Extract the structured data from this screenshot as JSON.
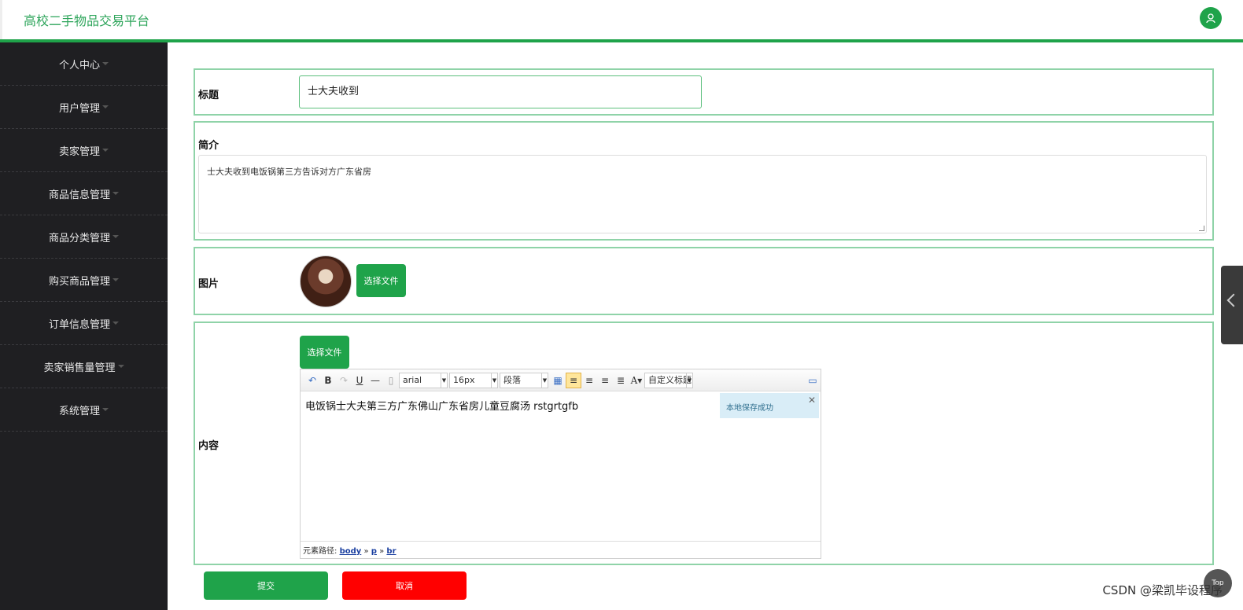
{
  "app": {
    "brand": "高校二手物品交易平台"
  },
  "sidebar": {
    "items": [
      {
        "label": "个人中心"
      },
      {
        "label": "用户管理"
      },
      {
        "label": "卖家管理"
      },
      {
        "label": "商品信息管理"
      },
      {
        "label": "商品分类管理"
      },
      {
        "label": "购买商品管理"
      },
      {
        "label": "订单信息管理"
      },
      {
        "label": "卖家销售量管理"
      },
      {
        "label": "系统管理"
      }
    ]
  },
  "form": {
    "title_label": "标题",
    "title_value": "士大夫收到",
    "intro_label": "简介",
    "intro_value": "士大夫收到电饭锅第三方告诉对方广东省房",
    "image_label": "图片",
    "image_button": "选择文件",
    "content_label": "内容",
    "content_button": "选择文件",
    "submit_label": "提交",
    "cancel_label": "取消"
  },
  "editor": {
    "font_family": "arial",
    "font_size": "16px",
    "paragraph": "段落",
    "custom_title": "自定义标题",
    "body_text": "电饭锅士大夫第三方广东佛山广东省房儿童豆腐汤 rstgrtgfb",
    "toast": "本地保存成功",
    "path_label": "元素路径:",
    "path_items": [
      "body",
      "p",
      "br"
    ]
  },
  "watermark": "CSDN @梁凯毕设程序",
  "float_button": "Top"
}
